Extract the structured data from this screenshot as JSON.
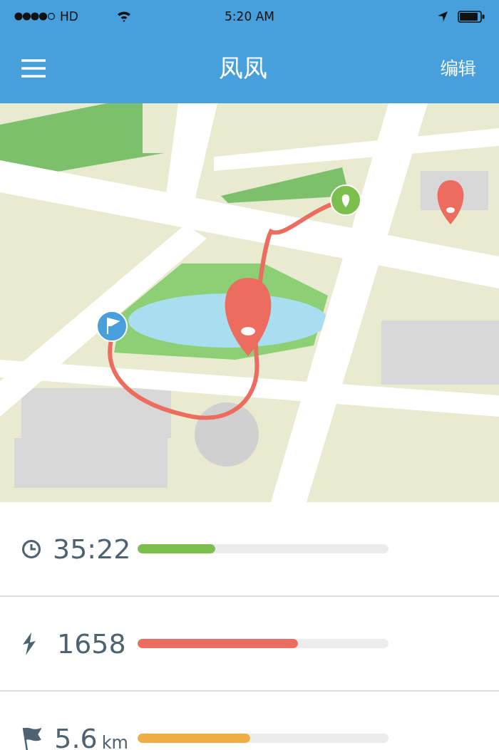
{
  "status_bar": {
    "carrier": "HD",
    "time": "5:20 AM"
  },
  "nav": {
    "title": "凤凤",
    "action": "编辑"
  },
  "stats": [
    {
      "kind": "time",
      "value": "35:22",
      "level": 0.31,
      "color": "#7dbf4f"
    },
    {
      "kind": "energy",
      "value": "1658",
      "level": 0.64,
      "color": "#ec6d60"
    },
    {
      "kind": "distance",
      "value": "5.6",
      "unit": "km",
      "level": 0.45,
      "color": "#efae44"
    }
  ]
}
